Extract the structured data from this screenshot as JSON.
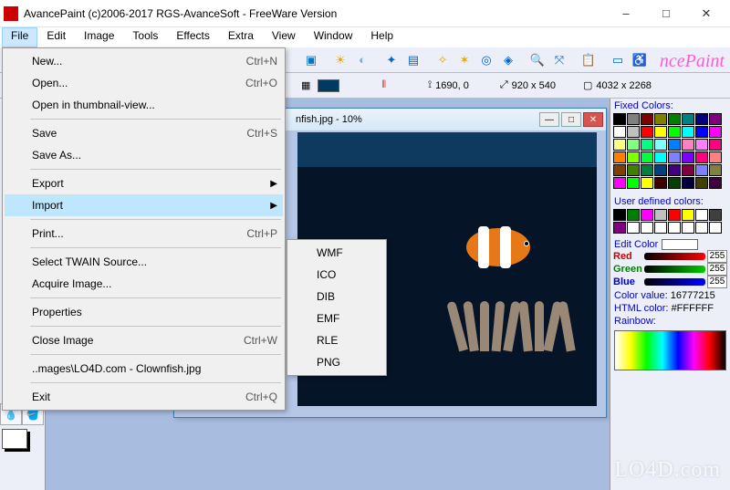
{
  "window": {
    "title": "AvancePaint (c)2006-2017 RGS-AvanceSoft  - FreeWare Version"
  },
  "menubar": {
    "items": [
      "File",
      "Edit",
      "Image",
      "Tools",
      "Effects",
      "Extra",
      "View",
      "Window",
      "Help"
    ]
  },
  "file_menu": [
    {
      "type": "item",
      "label": "New...",
      "shortcut": "Ctrl+N"
    },
    {
      "type": "item",
      "label": "Open...",
      "shortcut": "Ctrl+O"
    },
    {
      "type": "item",
      "label": "Open in thumbnail-view..."
    },
    {
      "type": "sep"
    },
    {
      "type": "item",
      "label": "Save",
      "shortcut": "Ctrl+S"
    },
    {
      "type": "item",
      "label": "Save As..."
    },
    {
      "type": "sep"
    },
    {
      "type": "submenu",
      "label": "Export"
    },
    {
      "type": "submenu",
      "label": "Import",
      "highlight": true
    },
    {
      "type": "sep"
    },
    {
      "type": "item",
      "label": "Print...",
      "shortcut": "Ctrl+P"
    },
    {
      "type": "sep"
    },
    {
      "type": "item",
      "label": "Select TWAIN Source..."
    },
    {
      "type": "item",
      "label": "Acquire Image..."
    },
    {
      "type": "sep"
    },
    {
      "type": "item",
      "label": "Properties"
    },
    {
      "type": "sep"
    },
    {
      "type": "item",
      "label": "Close Image",
      "shortcut": "Ctrl+W"
    },
    {
      "type": "sep"
    },
    {
      "type": "item",
      "label": "..mages\\LO4D.com - Clownfish.jpg"
    },
    {
      "type": "sep"
    },
    {
      "type": "item",
      "label": "Exit",
      "shortcut": "Ctrl+Q"
    }
  ],
  "import_submenu": [
    "WMF",
    "ICO",
    "DIB",
    "EMF",
    "RLE",
    "PNG"
  ],
  "doc": {
    "title": "nfish.jpg - 10%"
  },
  "infobar": {
    "coords": "1690, 0",
    "dims": "920 x 540",
    "full": "4032 x 2268"
  },
  "right": {
    "fixed_label": "Fixed Colors:",
    "user_label": "User defined colors:",
    "edit_label": "Edit Color",
    "red": "Red",
    "green": "Green",
    "blue": "Blue",
    "val_r": "255",
    "val_g": "255",
    "val_b": "255",
    "color_value_label": "Color value:",
    "color_value": "16777215",
    "html_label": "HTML color:",
    "html_value": "#FFFFFF",
    "rainbow_label": "Rainbow:"
  },
  "fixed_colors": [
    "#000000",
    "#808080",
    "#800000",
    "#808000",
    "#008000",
    "#008080",
    "#000080",
    "#800080",
    "#ffffff",
    "#c0c0c0",
    "#ff0000",
    "#ffff00",
    "#00ff00",
    "#00ffff",
    "#0000ff",
    "#ff00ff",
    "#ffff80",
    "#80ff80",
    "#00ff80",
    "#80ffff",
    "#0080ff",
    "#ff80c0",
    "#ff80ff",
    "#ff0080",
    "#ff8000",
    "#80ff00",
    "#00ff40",
    "#00ffff",
    "#8080ff",
    "#8000ff",
    "#ff0080",
    "#ff8080",
    "#804000",
    "#408000",
    "#008040",
    "#004080",
    "#400080",
    "#800040",
    "#8080ff",
    "#808040",
    "#ff00ff",
    "#00ff00",
    "#ffff00",
    "#400000",
    "#004000",
    "#000040",
    "#404000",
    "#400040"
  ],
  "user_colors": [
    "#000000",
    "#008000",
    "#ff00ff",
    "#c0c0c0",
    "#ff0000",
    "#ffff00",
    "#ffffff",
    "#404040",
    "#800080",
    "#ffffff",
    "#ffffff",
    "#ffffff",
    "#ffffff",
    "#ffffff",
    "#ffffff",
    "#ffffff"
  ],
  "brand": "ncePaint",
  "watermark": "LO4D.com"
}
